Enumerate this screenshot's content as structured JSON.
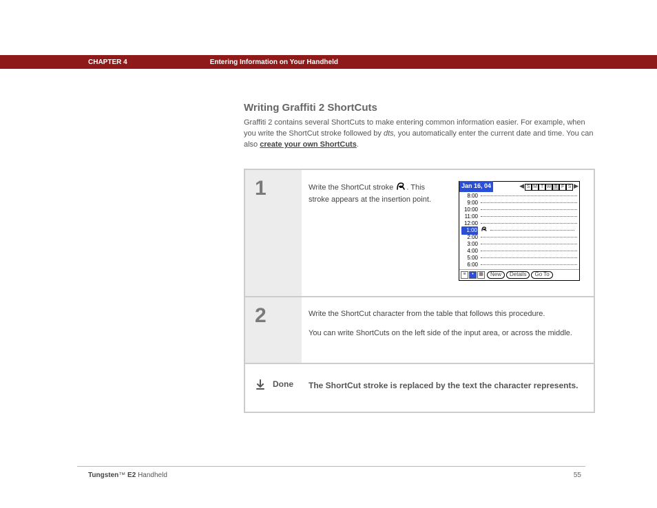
{
  "header": {
    "chapter": "CHAPTER 4",
    "title": "Entering Information on Your Handheld"
  },
  "section": {
    "title": "Writing Graffiti 2 ShortCuts",
    "intro_a": "Graffiti 2 contains several ShortCuts to make entering common information easier. For example, when you write the ShortCut stroke followed by ",
    "intro_em": "dts,",
    "intro_b": " you automatically enter the current date and time. You can also ",
    "intro_link": "create your own ShortCuts",
    "intro_c": "."
  },
  "steps": {
    "s1_num": "1",
    "s1_text_a": "Write the ShortCut stroke ",
    "s1_text_b": ". This stroke appears at the insertion point.",
    "s2_num": "2",
    "s2_line1": "Write the ShortCut character from the table that follows this procedure.",
    "s2_line2": "You can write ShortCuts on the left side of the input area, or across the middle."
  },
  "done": {
    "label": "Done",
    "text": "The ShortCut stroke is replaced by the text the character represents."
  },
  "shot": {
    "date": "Jan 16, 04",
    "days": [
      "S",
      "M",
      "T",
      "W",
      "T",
      "F",
      "S"
    ],
    "selected_day_index": 4,
    "hours": [
      "8:00",
      "9:00",
      "10:00",
      "11:00",
      "12:00",
      "1:00",
      "2:00",
      "3:00",
      "4:00",
      "5:00",
      "6:00"
    ],
    "selected_hour_index": 5,
    "buttons": [
      "New",
      "Details",
      "Go To"
    ]
  },
  "footer": {
    "product_a": "Tungsten",
    "tm": "™",
    "product_b": " E2 ",
    "suffix": "Handheld",
    "page": "55"
  }
}
